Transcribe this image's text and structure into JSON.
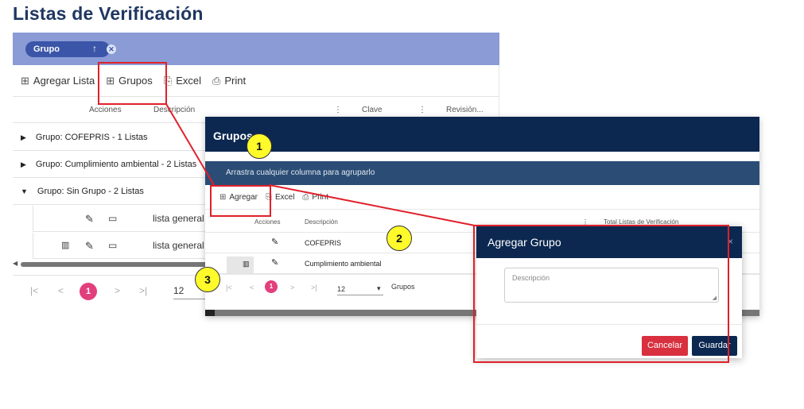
{
  "page": {
    "title": "Listas de Verificación"
  },
  "base": {
    "group_chip": {
      "label": "Grupo",
      "sort_icon": "arrow-up-icon",
      "remove_icon": "close-circle-icon"
    },
    "toolbar": {
      "add_list": "Agregar Lista",
      "groups": "Grupos",
      "excel": "Excel",
      "print": "Print"
    },
    "columns": {
      "actions": "Acciones",
      "description": "Descripción",
      "key": "Clave",
      "revision": "Revisión..."
    },
    "groups": [
      {
        "label": "Grupo: COFEPRIS - 1 Listas",
        "expanded": false
      },
      {
        "label": "Grupo: Cumplimiento ambiental - 2 Listas",
        "expanded": false
      },
      {
        "label": "Grupo: Sin Grupo - 2 Listas",
        "expanded": true
      }
    ],
    "rows": [
      {
        "description": "lista general p"
      },
      {
        "description": "lista general c"
      }
    ],
    "pager": {
      "first": "|<",
      "prev": "<",
      "current": "1",
      "next": ">",
      "last": ">|",
      "page_size": "12"
    }
  },
  "groups_dialog": {
    "title": "Grupos",
    "group_hint": "Arrastra cualquier columna para agruparlo",
    "toolbar": {
      "add": "Agregar",
      "excel": "Excel",
      "print": "Print"
    },
    "columns": {
      "actions": "Acciones",
      "description": "Descripción",
      "total": "Total Listas de Verificación"
    },
    "rows": [
      {
        "description": "COFEPRIS"
      },
      {
        "description": "Cumplimiento ambiental"
      }
    ],
    "pager": {
      "first": "|<",
      "prev": "<",
      "current": "1",
      "next": ">",
      "last": ">|",
      "page_size": "12",
      "label": "Grupos"
    }
  },
  "add_group_modal": {
    "title": "Agregar Grupo",
    "close": "×",
    "description_placeholder": "Descripción",
    "cancel": "Cancelar",
    "save": "Guardar"
  },
  "annotations": [
    "1",
    "2",
    "3"
  ],
  "colors": {
    "title": "#1f3760",
    "group_bar": "#8a9bd6",
    "header_navy": "#0c2851",
    "accent_pink": "#e23f7d",
    "cancel_red": "#d9303f",
    "callout_yellow": "#fffb2a",
    "callout_red": "#e0202a"
  }
}
